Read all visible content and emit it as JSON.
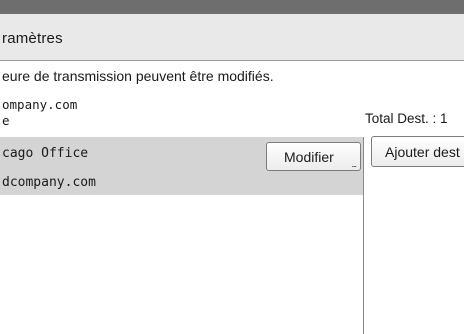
{
  "header": {
    "title": "ramètres"
  },
  "info": {
    "message": "eure de transmission peuvent être modifiés."
  },
  "sender": {
    "email": "ompany.com",
    "name": "e"
  },
  "summary": {
    "total_dest": "Total Dest. : 1"
  },
  "destinations": [
    {
      "name": "cago Office",
      "email": "dcompany.com"
    }
  ],
  "buttons": {
    "modify_label": "Modifier",
    "modify_dots": "...",
    "add_label": "Ajouter dest"
  },
  "colors": {
    "top_bar": "#6e6e6e",
    "title_bar": "#e9e9e9",
    "selected_row": "#d4d4d4"
  }
}
